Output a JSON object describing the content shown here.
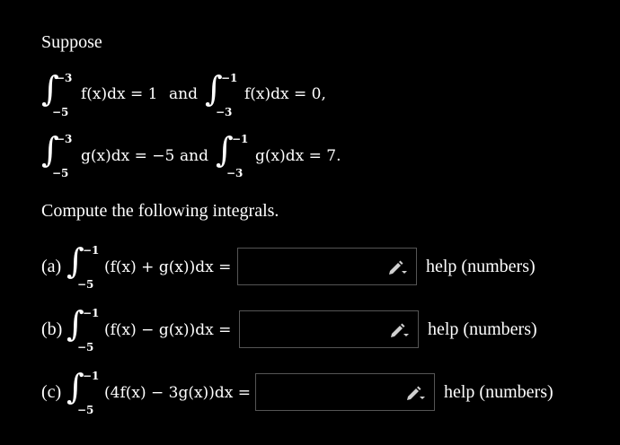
{
  "intro": "Suppose",
  "given": [
    {
      "lower": "−5",
      "upper": "−3",
      "expr": "f(x)dx = 1",
      "connector": "and"
    },
    {
      "lower": "−3",
      "upper": "−1",
      "expr": "f(x)dx = 0,"
    },
    {
      "lower": "−5",
      "upper": "−3",
      "expr": "g(x)dx = −5",
      "connector": "and"
    },
    {
      "lower": "−3",
      "upper": "−1",
      "expr": "g(x)dx = 7."
    }
  ],
  "instruction": "Compute the following integrals.",
  "parts": [
    {
      "label": "(a)",
      "lower": "−5",
      "upper": "−1",
      "expr": "(f(x) + g(x))dx =",
      "value": "",
      "help": "help (numbers)"
    },
    {
      "label": "(b)",
      "lower": "−5",
      "upper": "−1",
      "expr": "(f(x) − g(x))dx =",
      "value": "",
      "help": "help (numbers)"
    },
    {
      "label": "(c)",
      "lower": "−5",
      "upper": "−1",
      "expr": "(4f(x) − 3g(x))dx =",
      "value": "",
      "help": "help (numbers)"
    }
  ],
  "icons": {
    "pencil": "pencil-icon"
  },
  "colors": {
    "background": "#000000",
    "text": "#ffffff",
    "box_border": "#555555",
    "pencil": "#d0d0d0"
  }
}
